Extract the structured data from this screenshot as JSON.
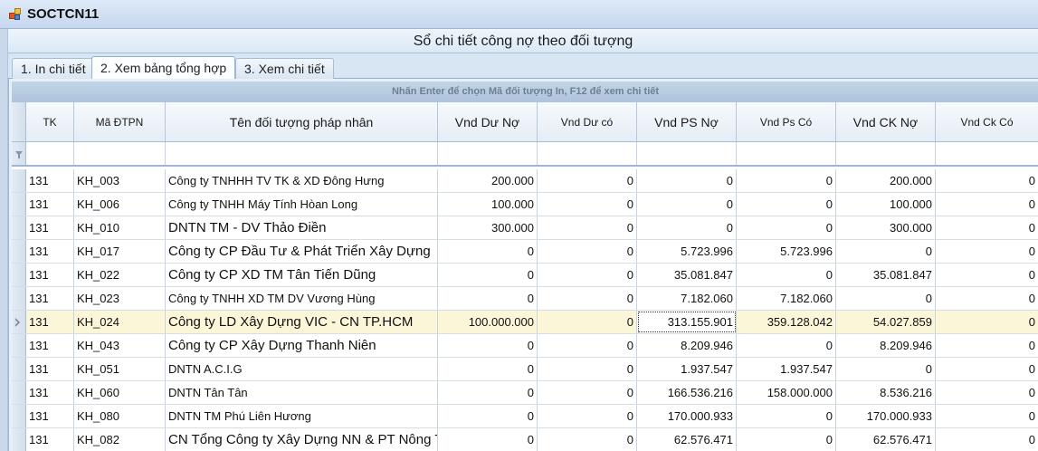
{
  "window": {
    "title": "SOCTCN11"
  },
  "form": {
    "title": "Sổ chi tiết công nợ theo đối tượng"
  },
  "tabs": [
    {
      "label": "1. In chi tiết",
      "active": false
    },
    {
      "label": "2. Xem bảng tổng hợp",
      "active": true
    },
    {
      "label": "3. Xem chi tiết",
      "active": false
    }
  ],
  "hint": "Nhấn Enter để chọn Mã đối tượng In, F12 để xem chi tiết",
  "columns": [
    "TK",
    "Mã ĐTPN",
    "Tên đối tượng pháp nhân",
    "Vnd Dư Nợ",
    "Vnd Dư có",
    "Vnd PS Nợ",
    "Vnd Ps Có",
    "Vnd CK Nợ",
    "Vnd Ck Có"
  ],
  "rows": [
    {
      "tk": "131",
      "ma": "KH_003",
      "ten": "Công ty TNHHH TV TK & XD Đông Hưng",
      "du_no": "200.000",
      "du_co": "0",
      "ps_no": "0",
      "ps_co": "0",
      "ck_no": "200.000",
      "ck_co": "0"
    },
    {
      "tk": "131",
      "ma": "KH_006",
      "ten": "Công ty TNHH Máy Tính Hòan Long",
      "du_no": "100.000",
      "du_co": "0",
      "ps_no": "0",
      "ps_co": "0",
      "ck_no": "100.000",
      "ck_co": "0"
    },
    {
      "tk": "131",
      "ma": "KH_010",
      "ten": "DNTN TM - DV Thảo Điền",
      "du_no": "300.000",
      "du_co": "0",
      "ps_no": "0",
      "ps_co": "0",
      "ck_no": "300.000",
      "ck_co": "0"
    },
    {
      "tk": "131",
      "ma": "KH_017",
      "ten": "Công ty CP Đầu Tư & Phát Triển Xây Dựng",
      "du_no": "0",
      "du_co": "0",
      "ps_no": "5.723.996",
      "ps_co": "5.723.996",
      "ck_no": "0",
      "ck_co": "0"
    },
    {
      "tk": "131",
      "ma": "KH_022",
      "ten": "Công ty CP XD TM Tân Tiến Dũng",
      "du_no": "0",
      "du_co": "0",
      "ps_no": "35.081.847",
      "ps_co": "0",
      "ck_no": "35.081.847",
      "ck_co": "0"
    },
    {
      "tk": "131",
      "ma": "KH_023",
      "ten": "Công ty TNHH XD TM DV Vương Hùng",
      "du_no": "0",
      "du_co": "0",
      "ps_no": "7.182.060",
      "ps_co": "7.182.060",
      "ck_no": "0",
      "ck_co": "0"
    },
    {
      "tk": "131",
      "ma": "KH_024",
      "ten": "Công ty LD Xây Dựng VIC - CN TP.HCM",
      "du_no": "100.000.000",
      "du_co": "0",
      "ps_no": "313.155.901",
      "ps_co": "359.128.042",
      "ck_no": "54.027.859",
      "ck_co": "0"
    },
    {
      "tk": "131",
      "ma": "KH_043",
      "ten": "Công ty CP Xây Dựng Thanh Niên",
      "du_no": "0",
      "du_co": "0",
      "ps_no": "8.209.946",
      "ps_co": "0",
      "ck_no": "8.209.946",
      "ck_co": "0"
    },
    {
      "tk": "131",
      "ma": "KH_051",
      "ten": "DNTN A.C.I.G",
      "du_no": "0",
      "du_co": "0",
      "ps_no": "1.937.547",
      "ps_co": "1.937.547",
      "ck_no": "0",
      "ck_co": "0"
    },
    {
      "tk": "131",
      "ma": "KH_060",
      "ten": "DNTN Tân Tân",
      "du_no": "0",
      "du_co": "0",
      "ps_no": "166.536.216",
      "ps_co": "158.000.000",
      "ck_no": "8.536.216",
      "ck_co": "0"
    },
    {
      "tk": "131",
      "ma": "KH_080",
      "ten": "DNTN TM Phú Liên Hương",
      "du_no": "0",
      "du_co": "0",
      "ps_no": "170.000.933",
      "ps_co": "0",
      "ck_no": "170.000.933",
      "ck_co": "0"
    },
    {
      "tk": "131",
      "ma": "KH_082",
      "ten": "CN Tổng Công ty Xây Dựng NN & PT Nông T...",
      "du_no": "0",
      "du_co": "0",
      "ps_no": "62.576.471",
      "ps_co": "0",
      "ck_no": "62.576.471",
      "ck_co": "0"
    }
  ]
}
